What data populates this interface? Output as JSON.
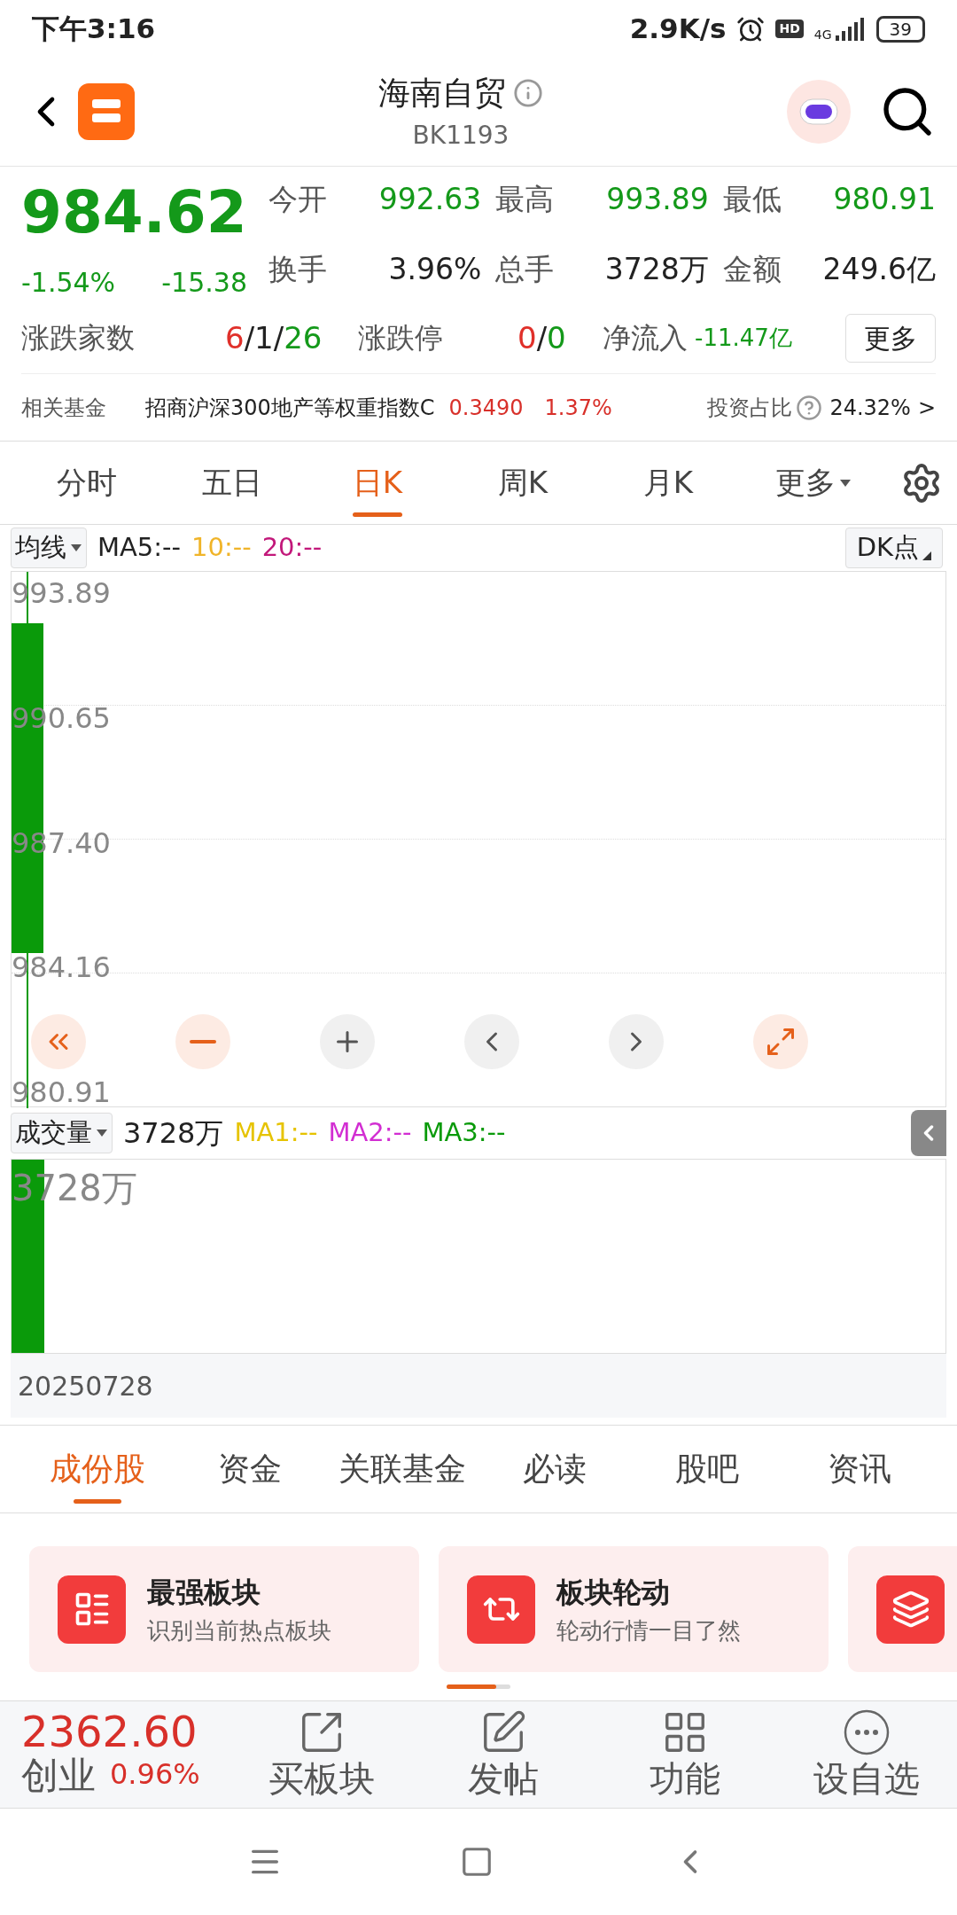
{
  "status_bar": {
    "time": "下午3:16",
    "speed": "2.9K/s",
    "hd": "HD",
    "network": "4G",
    "battery": "39"
  },
  "header": {
    "title": "海南自贸",
    "code": "BK1193"
  },
  "quote": {
    "price": "984.62",
    "change_pct": "-1.54%",
    "change": "-15.38",
    "stats": [
      {
        "label": "今开",
        "value": "992.63",
        "color": "#14991a"
      },
      {
        "label": "最高",
        "value": "993.89",
        "color": "#14991a"
      },
      {
        "label": "最低",
        "value": "980.91",
        "color": "#14991a"
      },
      {
        "label": "换手",
        "value": "3.96%",
        "color": "#222222"
      },
      {
        "label": "总手",
        "value": "3728万",
        "color": "#222222"
      },
      {
        "label": "金额",
        "value": "249.6亿",
        "color": "#222222"
      }
    ],
    "breadth_label": "涨跌家数",
    "breadth": [
      {
        "text": "6",
        "color": "#e0302a"
      },
      {
        "text": "/1/",
        "color": "#222222"
      },
      {
        "text": "26",
        "color": "#14991a"
      }
    ],
    "limit_label": "涨跌停",
    "limit": [
      {
        "text": "0",
        "color": "#e0302a"
      },
      {
        "text": "/",
        "color": "#222222"
      },
      {
        "text": "0",
        "color": "#14991a"
      }
    ],
    "inflow_label": "净流入",
    "inflow": "-11.47亿",
    "more_button": "更多"
  },
  "fund": {
    "label": "相关基金",
    "name": "招商沪深300地产等权重指数C",
    "nav": "0.3490",
    "pct": "1.37%",
    "ratio_label": "投资占比",
    "ratio": "24.32%",
    "arrow": ">"
  },
  "chart_tabs": [
    {
      "label": "分时",
      "selected": false
    },
    {
      "label": "五日",
      "selected": false
    },
    {
      "label": "日K",
      "selected": true
    },
    {
      "label": "周K",
      "selected": false
    },
    {
      "label": "月K",
      "selected": false
    },
    {
      "label": "更多",
      "selected": false
    }
  ],
  "ma_bar": {
    "selector": "均线",
    "items": [
      {
        "text": "MA5:--",
        "color": "#222222"
      },
      {
        "text": "10:--",
        "color": "#f0b429"
      },
      {
        "text": "20:--",
        "color": "#c2187a"
      }
    ],
    "dk_button": "DK点"
  },
  "price_axis": [
    "993.89",
    "990.65",
    "987.40",
    "984.16",
    "980.91"
  ],
  "chart_controls": [
    {
      "kind": "rewind"
    },
    {
      "kind": "zoom-out"
    },
    {
      "kind": "zoom-in"
    },
    {
      "kind": "prev"
    },
    {
      "kind": "next"
    },
    {
      "kind": "expand"
    }
  ],
  "volume_bar": {
    "selector": "成交量",
    "value": "3728万",
    "items": [
      {
        "text": "MA1:--",
        "color": "#e6c300"
      },
      {
        "text": "MA2:--",
        "color": "#d22ed2"
      },
      {
        "text": "MA3:--",
        "color": "#0a9a0a"
      }
    ]
  },
  "volume_axis": "3728万",
  "date": "20250728",
  "section_tabs": [
    {
      "label": "成份股",
      "selected": true
    },
    {
      "label": "资金",
      "selected": false
    },
    {
      "label": "关联基金",
      "selected": false
    },
    {
      "label": "必读",
      "selected": false
    },
    {
      "label": "股吧",
      "selected": false
    },
    {
      "label": "资讯",
      "selected": false
    }
  ],
  "cards": [
    {
      "kind": "ranking",
      "title": "最强板块",
      "subtitle": "识别当前热点板块"
    },
    {
      "kind": "rotation",
      "title": "板块轮动",
      "subtitle": "轮动行情一目了然"
    },
    {
      "kind": "layers"
    }
  ],
  "bottom_bar": {
    "index_value": "2362.60",
    "index_name": "创业",
    "index_pct": "0.96%",
    "actions": [
      {
        "kind": "buy",
        "label": "买板块"
      },
      {
        "kind": "post",
        "label": "发帖"
      },
      {
        "kind": "grid",
        "label": "功能"
      },
      {
        "kind": "more",
        "label": "设自选"
      }
    ]
  }
}
